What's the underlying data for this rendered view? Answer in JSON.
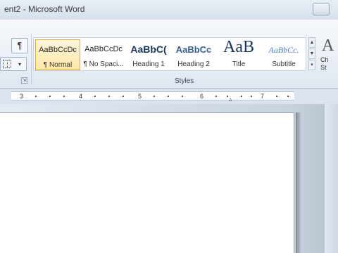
{
  "window": {
    "title": "ent2 - Microsoft Word"
  },
  "paragraph_group": {
    "pilcrow_symbol": "¶",
    "borders_dropdown_symbol": "▾",
    "launcher_symbol": "⇲"
  },
  "styles_group": {
    "label": "Styles",
    "scroll_up_symbol": "▲",
    "more_symbol": "▾",
    "styles": [
      {
        "sample": "AaBbCcDc",
        "label": "¶ Normal",
        "selected": true
      },
      {
        "sample": "AaBbCcDc",
        "label": "¶ No Spaci..."
      },
      {
        "sample": "AaBbC(",
        "label": "Heading 1"
      },
      {
        "sample": "AaBbCc",
        "label": "Heading 2"
      },
      {
        "sample": "AaB",
        "label": "Title"
      },
      {
        "sample": "AaBbCc.",
        "label": "Subtitle"
      }
    ]
  },
  "change_styles": {
    "glyph": "A",
    "line1": "Ch",
    "line2": "St"
  },
  "ruler": {
    "numbers": [
      "3",
      "4",
      "5",
      "6",
      "7"
    ],
    "indent_marker": "▵"
  }
}
